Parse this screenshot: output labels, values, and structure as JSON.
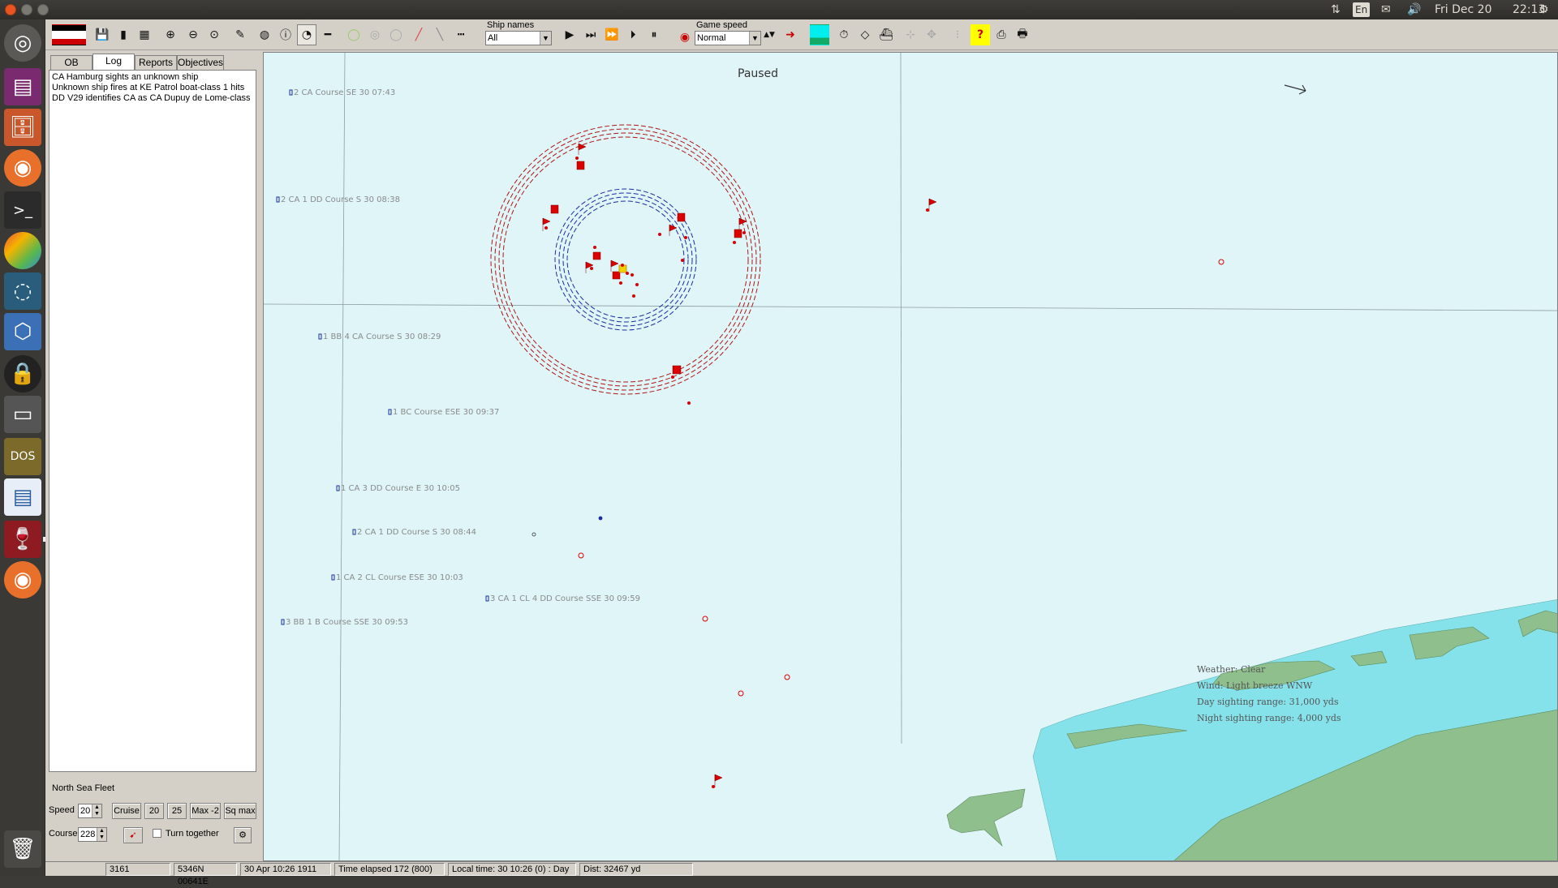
{
  "tray": {
    "language": "En",
    "date": "Fri Dec 20",
    "time": "22:13"
  },
  "toolbar": {
    "ship_names_label": "Ship names",
    "ship_names_value": "All",
    "game_speed_label": "Game speed",
    "game_speed_value": "Normal"
  },
  "tabs": [
    "OB",
    "Log",
    "Reports",
    "Objectives"
  ],
  "log": [
    "CA Hamburg sights an unknown ship",
    "Unknown ship fires at KE Patrol boat-class 1 hits",
    "DD V29 identifies CA as CA Dupuy de Lome-class"
  ],
  "fleet": {
    "name": "North Sea Fleet",
    "speed_label": "Speed",
    "speed_value": "20",
    "cruise_label": "Cruise",
    "btn_20": "20",
    "btn_25": "25",
    "btn_max2": "Max -2",
    "btn_sqmax": "Sq max",
    "course_label": "Course",
    "course_value": "228",
    "turn_together_label": "Turn together"
  },
  "map": {
    "paused_label": "Paused",
    "groups": [
      "2 CA Course SE 30 07:43",
      "2 CA 1 DD Course S 30 08:38",
      "1 BB 4 CA Course S 30 08:29",
      "1 BC Course ESE 30 09:37",
      "1 CA 3 DD Course E 30 10:05",
      "2 CA 1 DD Course S 30 08:44",
      "1 CA 2 CL Course ESE 30 10:03",
      "3 CA 1 CL 4 DD Course SSE 30 09:59",
      "3 BB 1 B Course SSE 30 09:53"
    ],
    "weather": {
      "weather": "Weather: Clear",
      "wind": "Wind: Light breeze  WNW",
      "day_range": "Day sighting range: 31,000 yds",
      "night_range": "Night sighting range: 4,000 yds"
    }
  },
  "status": {
    "id": "3161",
    "position": "5346N 00641E",
    "datetime": "30 Apr 10:26 1911",
    "elapsed": "Time elapsed 172 (800)",
    "local_time": "Local time: 30 10:26 (0) : Day",
    "distance": "Dist: 32467 yd"
  },
  "colors": {
    "sea": "#e0f5f8",
    "shallow": "#86e2ea",
    "land": "#8fbf8c",
    "enemy": "#dd0000",
    "friendly": "#1a2ea0",
    "selected": "#f5d000"
  }
}
